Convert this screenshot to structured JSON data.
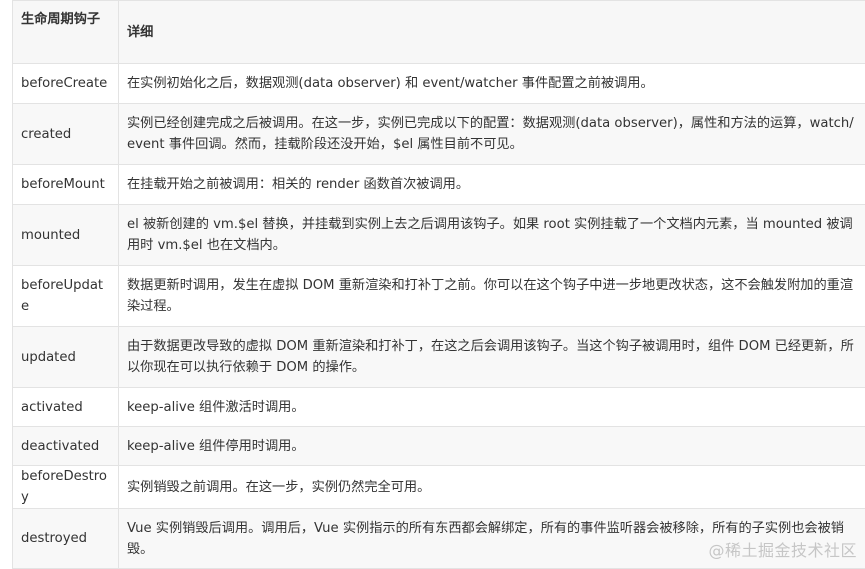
{
  "table": {
    "headers": [
      "生命周期钩子",
      "详细"
    ],
    "rows": [
      {
        "hook": "beforeCreate",
        "detail": "在实例初始化之后，数据观测(data observer) 和 event/watcher 事件配置之前被调用。"
      },
      {
        "hook": "created",
        "detail": "实例已经创建完成之后被调用。在这一步，实例已完成以下的配置：数据观测(data observer)，属性和方法的运算，watch/event 事件回调。然而，挂载阶段还没开始，$el 属性目前不可见。"
      },
      {
        "hook": "beforeMount",
        "detail": "在挂载开始之前被调用：相关的 render 函数首次被调用。"
      },
      {
        "hook": "mounted",
        "detail": "el 被新创建的 vm.$el 替换，并挂载到实例上去之后调用该钩子。如果 root 实例挂载了一个文档内元素，当 mounted 被调用时 vm.$el 也在文档内。"
      },
      {
        "hook": "beforeUpdate",
        "detail": "数据更新时调用，发生在虚拟 DOM 重新渲染和打补丁之前。你可以在这个钩子中进一步地更改状态，这不会触发附加的重渲染过程。"
      },
      {
        "hook": "updated",
        "detail": "由于数据更改导致的虚拟 DOM 重新渲染和打补丁，在这之后会调用该钩子。当这个钩子被调用时，组件 DOM 已经更新，所以你现在可以执行依赖于 DOM 的操作。"
      },
      {
        "hook": "activated",
        "detail": "keep-alive 组件激活时调用。"
      },
      {
        "hook": "deactivated",
        "detail": "keep-alive 组件停用时调用。"
      },
      {
        "hook": "beforeDestroy",
        "detail": "实例销毁之前调用。在这一步，实例仍然完全可用。"
      },
      {
        "hook": "destroyed",
        "detail": "Vue 实例销毁后调用。调用后，Vue 实例指示的所有东西都会解绑定，所有的事件监听器会被移除，所有的子实例也会被销毁。"
      }
    ]
  },
  "watermark": "@稀土掘金技术社区",
  "colors": {
    "header_bg": "#f7f7f7",
    "stripe_bg": "#f8f8f8",
    "border": "#e3e3e3",
    "text": "#333333",
    "watermark": "#c6c6c6"
  }
}
